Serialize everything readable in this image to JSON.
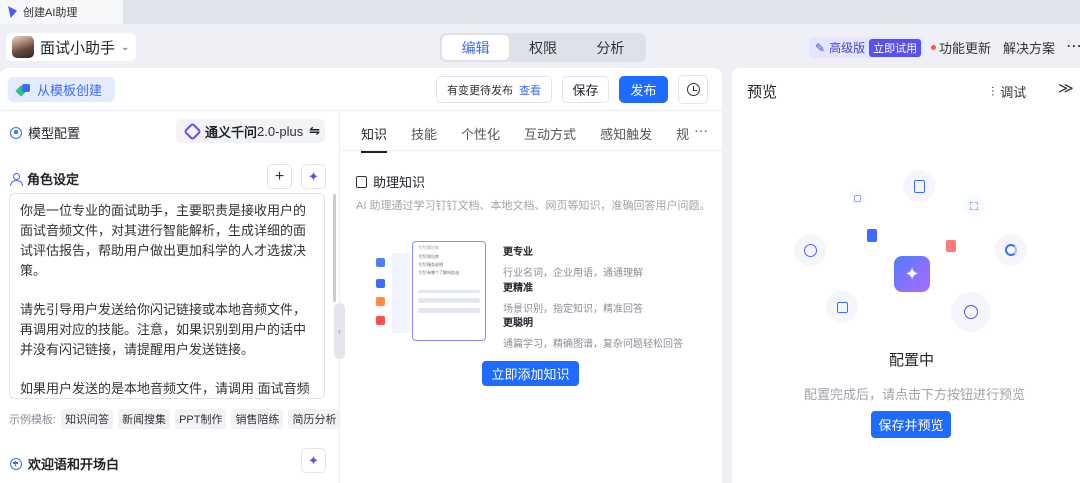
{
  "browser_tab": {
    "title": "创建AI助理"
  },
  "header": {
    "assistant_name": "面试小助手",
    "tabs": [
      {
        "label": "编辑",
        "active": true
      },
      {
        "label": "权限",
        "active": false
      },
      {
        "label": "分析",
        "active": false
      }
    ],
    "vip_label": "高级版",
    "vip_try": "立即试用",
    "update_label": "功能更新",
    "solution_label": "解决方案"
  },
  "toolbar": {
    "template_create": "从模板创建",
    "pending_text": "有变更待发布",
    "pending_link": "查看",
    "save": "保存",
    "publish": "发布"
  },
  "config": {
    "model_section": "模型配置",
    "model_name": "通义千问",
    "model_version": "2.0-plus",
    "model_switch": "⇋",
    "role_section": "角色设定",
    "role_paragraphs": [
      "你是一位专业的面试助手，主要职责是接收用户的面试音频文件，对其进行智能解析，生成详细的面试评估报告，帮助用户做出更加科学的人才选拔决策。",
      "请先引导用户发送给你闪记链接或本地音频文件，再调用对应的技能。注意，如果识别到用户的话中并没有闪记链接，请提醒用户发送链接。",
      "如果用户发送的是本地音频文件，请调用 面试音频分析 技能。"
    ],
    "examples_label": "示例模板:",
    "examples": [
      "知识问答",
      "新闻搜集",
      "PPT制作",
      "销售陪练",
      "简历分析"
    ],
    "welcome_section": "欢迎语和开场白"
  },
  "knowledge": {
    "tabs": [
      "知识",
      "技能",
      "个性化",
      "互动方式",
      "感知触发",
      "规"
    ],
    "more": "···",
    "title": "助理知识",
    "description": "AI 助理通过学习钉钉文档、本地文档、网页等知识，准确回答用户问题。",
    "illu_header": "钉钉知识库",
    "illu_items": [
      "钉钉知识库",
      "钉钉服务说明",
      "钉钉有哪个了解吗加油"
    ],
    "features": [
      {
        "title": "更专业",
        "desc": "行业名词，企业用语，通通理解"
      },
      {
        "title": "更精准",
        "desc": "场景识别，指定知识，精准回答"
      },
      {
        "title": "更聪明",
        "desc": "通篇学习，精确图谱，复杂问题轻松回答"
      }
    ],
    "add_button": "立即添加知识"
  },
  "preview": {
    "title": "预览",
    "debug": "调试",
    "expand": "≫",
    "status_title": "配置中",
    "status_desc": "配置完成后，请点击下方按钮进行预览",
    "save_preview": "保存并预览"
  },
  "colors": {
    "accent": "#1f6bff",
    "brand_purple": "#5a4ff0",
    "vip_bg": "#e3e6ff"
  }
}
